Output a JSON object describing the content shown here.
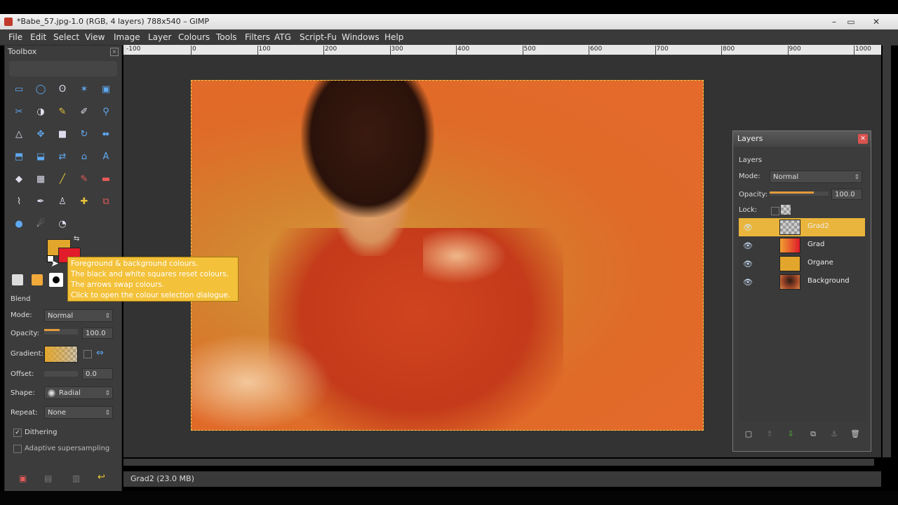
{
  "window": {
    "title": "*Babe_57.jpg-1.0 (RGB, 4 layers) 788x540 – GIMP",
    "minimize": "–",
    "maximize": "▭",
    "close": "✕"
  },
  "menu": [
    "File",
    "Edit",
    "Select",
    "View",
    "Image",
    "Layer",
    "Colours",
    "Tools",
    "Filters",
    "ATG",
    "Script-Fu",
    "Windows",
    "Help"
  ],
  "toolbox": {
    "title": "Toolbox",
    "close_icon": "×",
    "tools": [
      [
        "rect-select-icon",
        "ellipse-select-icon",
        "lasso-icon",
        "fuzzy-select-icon",
        "by-color-select-icon"
      ],
      [
        "scissors-select-icon",
        "foreground-select-icon",
        "paths-icon",
        "color-picker-icon",
        "zoom-icon"
      ],
      [
        "measure-icon",
        "move-icon",
        "crop-icon",
        "rotate-icon",
        "scale-icon"
      ],
      [
        "shear-icon",
        "perspective-icon",
        "flip-icon",
        "cage-icon",
        "text-icon"
      ],
      [
        "bucket-fill-icon",
        "blend-icon",
        "pencil-icon",
        "paintbrush-icon",
        "eraser-icon"
      ],
      [
        "airbrush-icon",
        "ink-icon",
        "clone-icon",
        "heal-icon",
        "perspective-clone-icon"
      ],
      [
        "blur-icon",
        "smudge-icon",
        "dodge-burn-icon"
      ]
    ],
    "tool_glyphs": [
      [
        "▭",
        "◯",
        "ʘ",
        "✶",
        "▣"
      ],
      [
        "✂",
        "◑",
        "✎",
        "✐",
        "⚲"
      ],
      [
        "△",
        "✥",
        "■",
        "↻",
        "⬌"
      ],
      [
        "⬒",
        "⬓",
        "⇄",
        "⌂",
        "A"
      ],
      [
        "◆",
        "▦",
        "╱",
        "✎",
        "▬"
      ],
      [
        "⌇",
        "✒",
        "♙",
        "✚",
        "⧉"
      ],
      [
        "●",
        "☄",
        "◔"
      ]
    ],
    "fg_color": "#e3a62c",
    "bg_color": "#e21c2a"
  },
  "tooltip": {
    "lines": [
      "Foreground & background colours.",
      "The black and white squares reset colours.",
      "The arrows swap colours.",
      "Click to open the colour selection dialogue."
    ]
  },
  "tool_options": {
    "section": "Blend",
    "mode_label": "Mode:",
    "mode_value": "Normal",
    "opacity_label": "Opacity:",
    "opacity_value": "100.0",
    "gradient_label": "Gradient:",
    "offset_label": "Offset:",
    "offset_value": "0.0",
    "shape_label": "Shape:",
    "shape_value": "Radial",
    "repeat_label": "Repeat:",
    "repeat_value": "None",
    "dithering_label": "Dithering",
    "dithering_checked": true,
    "adaptive_label": "Adaptive supersampling",
    "adaptive_checked": false
  },
  "ruler": {
    "labels": [
      "0",
      "100",
      "200",
      "300",
      "400",
      "500",
      "600",
      "700",
      "800",
      "900",
      "1000"
    ],
    "first_label": "-100"
  },
  "status": {
    "text": "Grad2 (23.0 MB)"
  },
  "layers": {
    "title": "Layers",
    "subtitle": "Layers",
    "mode_label": "Mode:",
    "mode_value": "Normal",
    "opacity_label": "Opacity:",
    "opacity_value": "100.0",
    "lock_label": "Lock:",
    "items": [
      {
        "name": "Grad2",
        "selected": true,
        "thumb": "checker"
      },
      {
        "name": "Grad",
        "selected": false,
        "thumb": "#e03a2a"
      },
      {
        "name": "Organe",
        "selected": false,
        "thumb": "#e3a62c"
      },
      {
        "name": "Background",
        "selected": false,
        "thumb": "#7a3a2a"
      }
    ]
  }
}
